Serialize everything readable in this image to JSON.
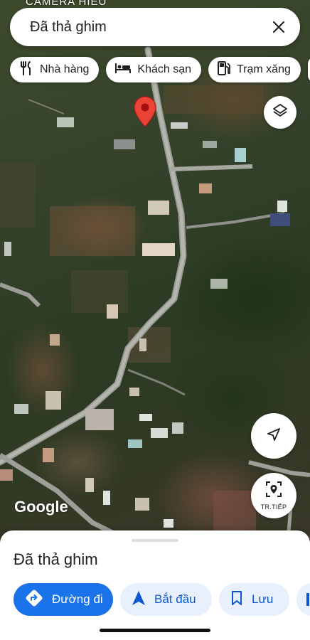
{
  "map": {
    "caption_text": "CAMERA HIEU",
    "attribution": "Google"
  },
  "search": {
    "value": "Đã thả ghim",
    "close_icon": "close-icon"
  },
  "chips": [
    {
      "label": "Nhà hàng",
      "icon": "restaurant-icon"
    },
    {
      "label": "Khách sạn",
      "icon": "hotel-icon"
    },
    {
      "label": "Trạm xăng",
      "icon": "gas-station-icon"
    }
  ],
  "controls": {
    "layers_icon": "layers-icon",
    "navigate_icon": "navigation-arrow-icon",
    "next_label": "TR.TIẾP",
    "next_icon": "location-pin-scan-icon"
  },
  "pin": {
    "color": "#ea4335"
  },
  "sheet": {
    "title": "Đã thả ghim",
    "actions": [
      {
        "label": "Đường đi",
        "icon": "directions-icon"
      },
      {
        "label": "Bắt đầu",
        "icon": "navigation-icon"
      },
      {
        "label": "Lưu",
        "icon": "bookmark-icon"
      }
    ]
  },
  "colors": {
    "primary": "#1a73e8",
    "secondary_bg": "#e8f0fe",
    "secondary_text": "#0b57d0"
  }
}
